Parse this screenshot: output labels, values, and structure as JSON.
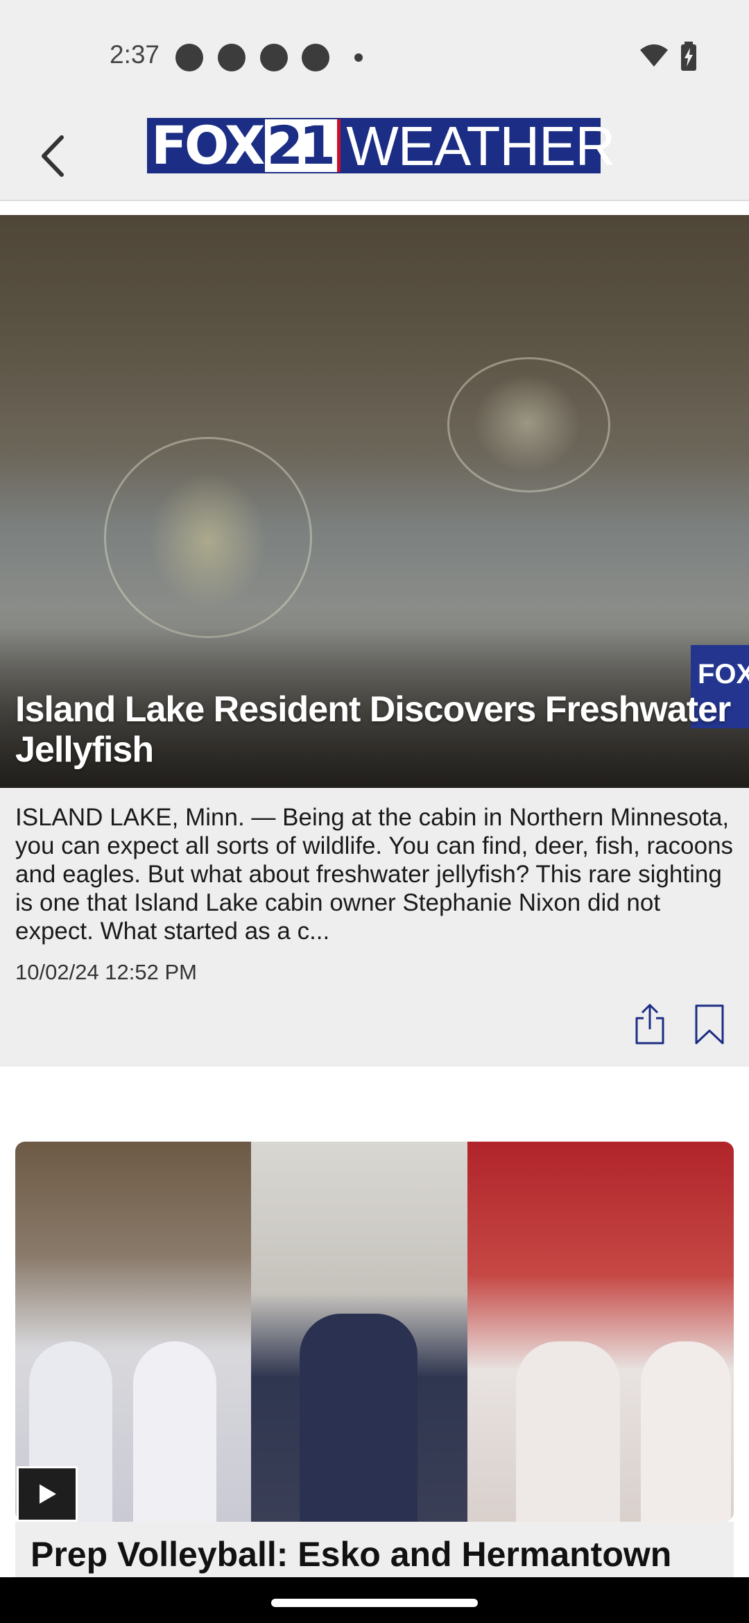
{
  "status_bar": {
    "time": "2:37",
    "icons": [
      "notification-dot-icon",
      "wifi-icon",
      "battery-charging-icon"
    ]
  },
  "header": {
    "back_icon": "chevron-left-icon",
    "logo": {
      "part1": "FOX",
      "part2": "21",
      "part3": "WEATHER"
    }
  },
  "feature": {
    "title": "Island Lake Resident Discovers Freshwater Jellyfish",
    "body": "ISLAND LAKE, Minn. — Being at the cabin in Northern Minnesota, you can expect all sorts of wildlife. You can find, deer, fish, racoons and eagles. But what about freshwater jellyfish? This rare sighting is one that Island Lake cabin owner Stephanie Nixon did not expect. What started as a c...",
    "date": "10/02/24 12:52 PM",
    "bug_text": "FOX",
    "share_icon": "share-icon",
    "bookmark_icon": "bookmark-icon"
  },
  "second": {
    "title": "Prep Volleyball: Esko and Hermantown",
    "play_icon": "play-icon"
  },
  "colors": {
    "brand_blue": "#1b2d84",
    "accent_red": "#c8102e",
    "card_bg": "#eeeeee",
    "icon_blue": "#1b2d84"
  }
}
